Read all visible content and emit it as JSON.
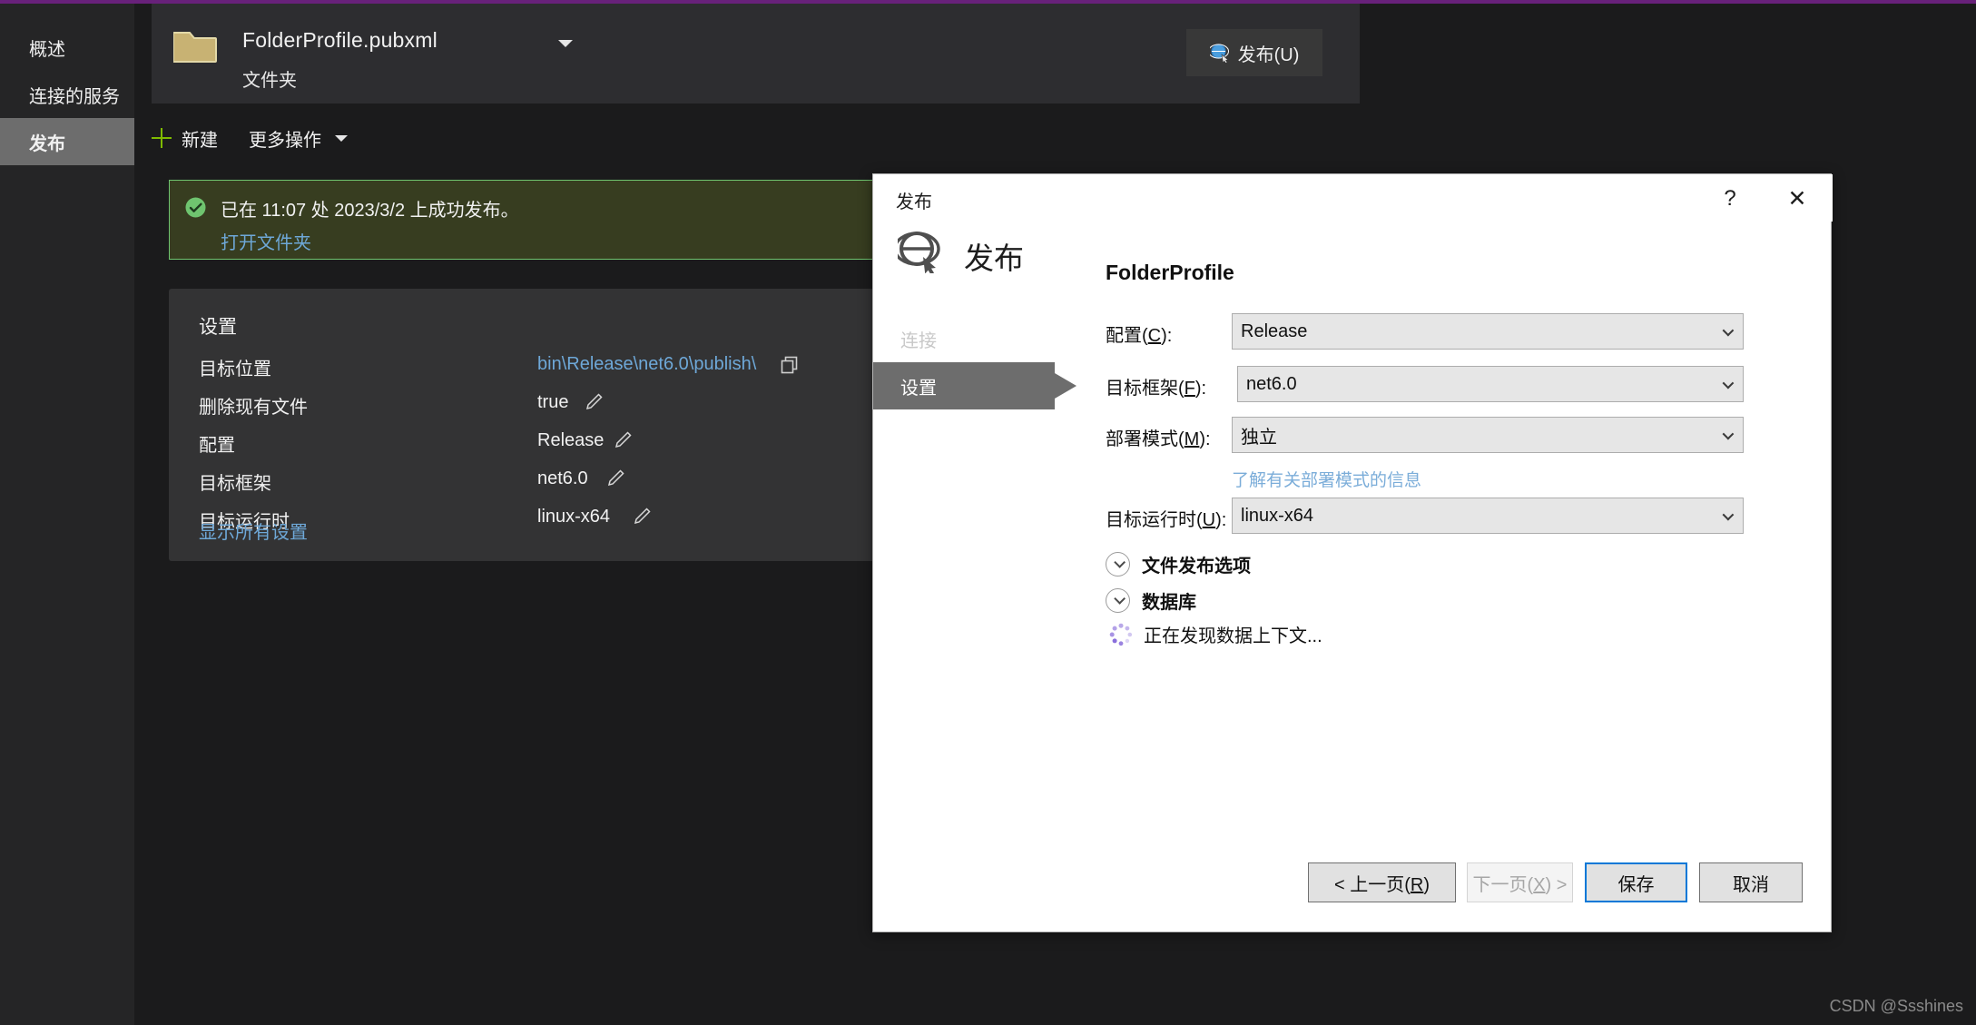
{
  "sidebar": {
    "items": [
      {
        "label": "概述",
        "active": false
      },
      {
        "label": "连接的服务",
        "active": false
      },
      {
        "label": "发布",
        "active": true
      }
    ]
  },
  "profile": {
    "icon": "folder-icon",
    "name": "FolderProfile.pubxml",
    "subtitle": "文件夹",
    "publish_button": "发布(U)"
  },
  "toolbar": {
    "new_label": "新建",
    "more_label": "更多操作"
  },
  "banner": {
    "message": "已在 11:07 处 2023/3/2 上成功发布。",
    "link": "打开文件夹",
    "status_color": "#6fc46f"
  },
  "settings": {
    "title": "设置",
    "rows": [
      {
        "label": "目标位置",
        "value": "bin\\Release\\net6.0\\publish\\",
        "is_link": true,
        "action_icon": "copy-icon"
      },
      {
        "label": "删除现有文件",
        "value": "true",
        "is_link": false,
        "action_icon": "pencil-icon"
      },
      {
        "label": "配置",
        "value": "Release",
        "is_link": false,
        "action_icon": "pencil-icon"
      },
      {
        "label": "目标框架",
        "value": "net6.0",
        "is_link": false,
        "action_icon": "pencil-icon"
      },
      {
        "label": "目标运行时",
        "value": "linux-x64",
        "is_link": false,
        "action_icon": "pencil-icon"
      }
    ],
    "show_all_link": "显示所有设置"
  },
  "dialog": {
    "titlebar_title": "发布",
    "help_glyph": "?",
    "close_glyph": "✕",
    "header_title": "发布",
    "header_icon": "globe-publish-icon",
    "nav": [
      {
        "label": "连接",
        "state": "disabled"
      },
      {
        "label": "设置",
        "state": "active"
      }
    ],
    "form": {
      "heading": "FolderProfile",
      "fields": [
        {
          "label_prefix": "配置(",
          "accel": "C",
          "label_suffix": "):",
          "value": "Release"
        },
        {
          "label_prefix": "目标框架(",
          "accel": "F",
          "label_suffix": "):",
          "value": "net6.0"
        },
        {
          "label_prefix": "部署模式(",
          "accel": "M",
          "label_suffix": "):",
          "value": "独立"
        },
        {
          "label_prefix": "目标运行时(",
          "accel": "U",
          "label_suffix": "):",
          "value": "linux-x64"
        }
      ],
      "deployment_hint": "了解有关部署模式的信息",
      "sections": [
        {
          "label": "文件发布选项"
        },
        {
          "label": "数据库"
        }
      ],
      "loading_text": "正在发现数据上下文..."
    },
    "footer": {
      "prev_prefix": "< 上一页(",
      "prev_accel": "R",
      "prev_suffix": ")",
      "next_prefix": "下一页(",
      "next_accel": "X",
      "next_suffix": ") >",
      "save": "保存",
      "cancel": "取消"
    }
  },
  "watermark": "CSDN @Ssshines",
  "colors": {
    "accent_purple": "#68217a",
    "success_green": "#6fc46f",
    "link_blue": "#6ea8d8",
    "focus_blue": "#0078d7"
  }
}
